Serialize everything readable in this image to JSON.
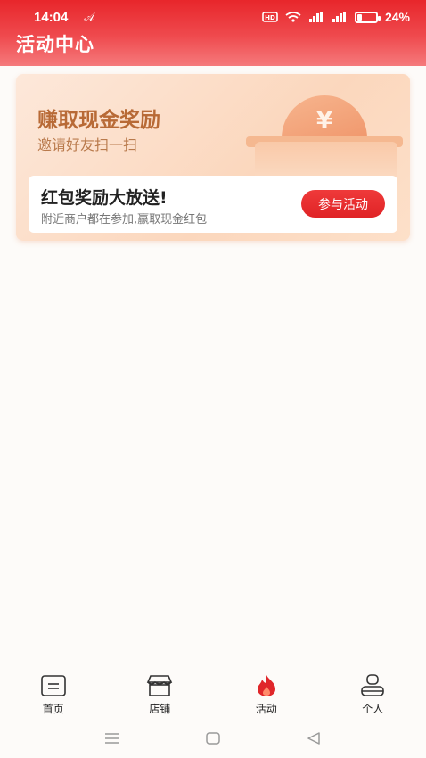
{
  "status_bar": {
    "time": "14:04",
    "extra": "𝒜",
    "battery": "24%",
    "battery_level": 0.24
  },
  "header": {
    "title": "活动中心"
  },
  "activity_card": {
    "title": "赚取现金奖励",
    "subtitle": "邀请好友扫一扫",
    "coin_symbol": "¥",
    "promo": {
      "title": "红包奖励大放送!",
      "description": "附近商户都在参加,赢取现金红包",
      "button_label": "参与活动"
    }
  },
  "bottom_nav": {
    "items": [
      {
        "label": "首页",
        "icon": "home-icon",
        "active": false
      },
      {
        "label": "店铺",
        "icon": "store-icon",
        "active": false
      },
      {
        "label": "活动",
        "icon": "flame-icon",
        "active": true
      },
      {
        "label": "个人",
        "icon": "person-icon",
        "active": false
      }
    ]
  },
  "colors": {
    "accent": "#e8262b",
    "card_title": "#b86a36",
    "button": "#e02326"
  }
}
